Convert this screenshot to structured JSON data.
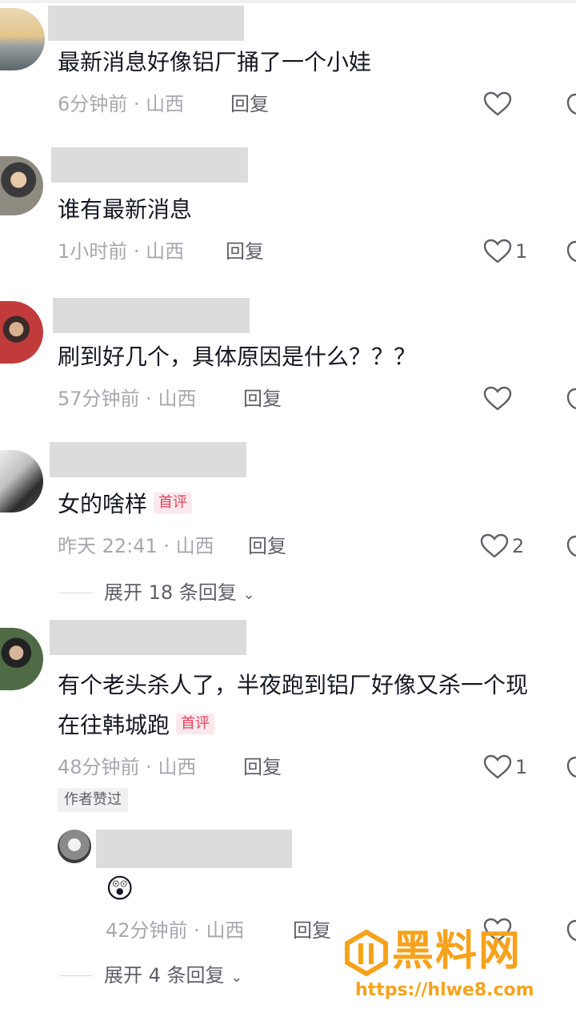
{
  "comments": [
    {
      "content": "最新消息好像铝厂捅了一个小娃",
      "time": "6分钟前",
      "location": "山西",
      "reply": "回复",
      "likes": ""
    },
    {
      "content": "谁有最新消息",
      "time": "1小时前",
      "location": "山西",
      "reply": "回复",
      "likes": "1"
    },
    {
      "content": "刷到好几个，具体原因是什么？？？",
      "time": "57分钟前",
      "location": "山西",
      "reply": "回复",
      "likes": ""
    },
    {
      "content": "女的啥样",
      "badge": "首评",
      "time": "昨天 22:41",
      "location": "山西",
      "reply": "回复",
      "likes": "2",
      "expand": "展开 18 条回复"
    },
    {
      "content_line1": "有个老头杀人了，半夜跑到铝厂好像又杀一个现",
      "content_line2": "在往韩城跑",
      "badge": "首评",
      "time": "48分钟前",
      "location": "山西",
      "reply": "回复",
      "likes": "1",
      "author_tag": "作者赞过"
    }
  ],
  "sub_reply": {
    "emoji": "😲",
    "time": "42分钟前",
    "location": "山西",
    "reply": "回复",
    "expand": "展开 4 条回复"
  },
  "watermark": {
    "title": "黑料网",
    "url": "https://hlwe8.com"
  },
  "colors": {
    "badge_text": "#e0455e",
    "badge_bg": "#fbe8ec",
    "meta": "#a7a8ad",
    "watermark": "#f7a21b"
  }
}
